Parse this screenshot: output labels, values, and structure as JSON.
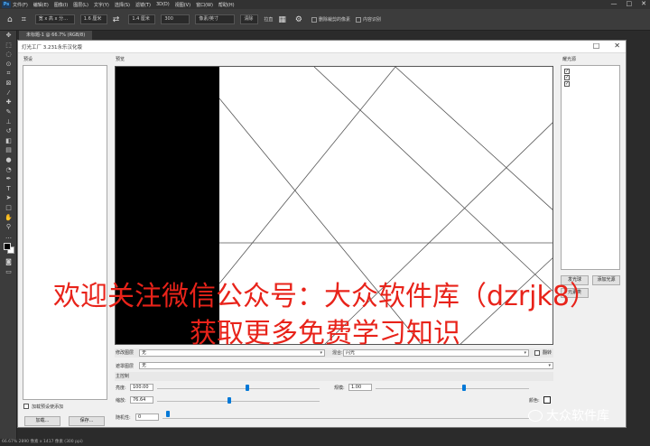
{
  "app": {
    "logo": "Ps"
  },
  "menu": [
    "文件(F)",
    "编辑(E)",
    "图像(I)",
    "图层(L)",
    "文字(Y)",
    "选择(S)",
    "滤镜(T)",
    "3D(D)",
    "视图(V)",
    "窗口(W)",
    "帮助(H)"
  ],
  "window_controls": [
    "—",
    "□",
    "✕"
  ],
  "options": {
    "field1": "宽 x 高 x 分…",
    "field2": "1.6 厘米",
    "field3": "1.4 厘米",
    "field4": "300",
    "unit": "像素/英寸",
    "clear_btn": "清除",
    "straighten": "拉直",
    "delete_cropped": "删除裁剪的像素",
    "content_aware": "内容识别"
  },
  "doc_tab": "未标题-1 @ 66.7% (RGB/8)",
  "status": "66.67%   2890 像素 x 1417 像素 (300 ppi)",
  "dialog": {
    "title": "灯光工厂 3.231永乐汉化版",
    "presets_label": "预设",
    "preview_label": "预览",
    "flares_label": "耀光源",
    "load_preset_checkbox": "加载预设使添加",
    "load_btn": "加载...",
    "save_btn": "保存...",
    "add_flare_btn": "发光球",
    "add_light_btn": "添加光源",
    "del_flare_btn": "元素类",
    "source_layer_label": "修改图层",
    "source_layer_value": "无",
    "blend_label": "混合:",
    "blend_value": "闪光",
    "flip_label": "翻转",
    "mask_layer_label": "遮罩图层",
    "mask_layer_value": "无",
    "main_control_label": "主控制",
    "brightness_label": "亮度:",
    "brightness_value": "100.00",
    "scale_label": "缩放:",
    "scale_value": "76.64",
    "randomize_label": "随机性:",
    "randomize_value": "0",
    "size_label": "规模:",
    "size_value": "1.00",
    "color_label": "颜色:",
    "brightness_slider": 0.37,
    "size_slider": 0.75,
    "scale_slider": 0.29,
    "randomize_slider": 0.02
  },
  "watermark": {
    "line1": "欢迎关注微信公众号：大众软件库（dzrjk8）",
    "line2": "获取更多免费学习知识",
    "wechat": "大众软件库"
  }
}
